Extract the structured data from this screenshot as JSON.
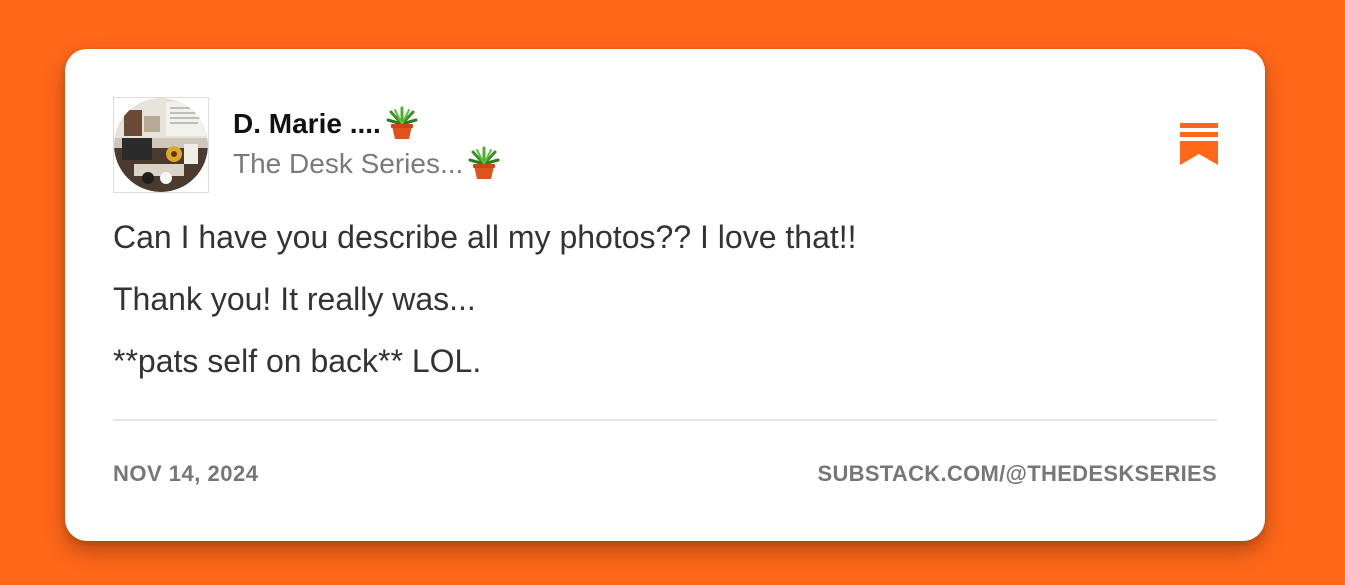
{
  "post": {
    "author_name": "D. Marie ....",
    "publication_name": "The Desk Series...",
    "author_name_icon": "potted-plant-icon",
    "publication_icon": "potted-plant-icon",
    "lines": [
      "Can I have you describe all my photos?? I love that!!",
      "Thank you! It really was...",
      "**pats self on back** LOL."
    ]
  },
  "footer": {
    "date": "NOV 14, 2024",
    "url": "SUBSTACK.COM/@THEDESKSERIES"
  },
  "icons": {
    "brand": "substack-bookmark-icon",
    "avatar": "avatar"
  },
  "colors": {
    "background": "#FF6719",
    "accent": "#FF6719",
    "card": "#ffffff",
    "text": "#333333",
    "muted": "#7a7a7a"
  }
}
